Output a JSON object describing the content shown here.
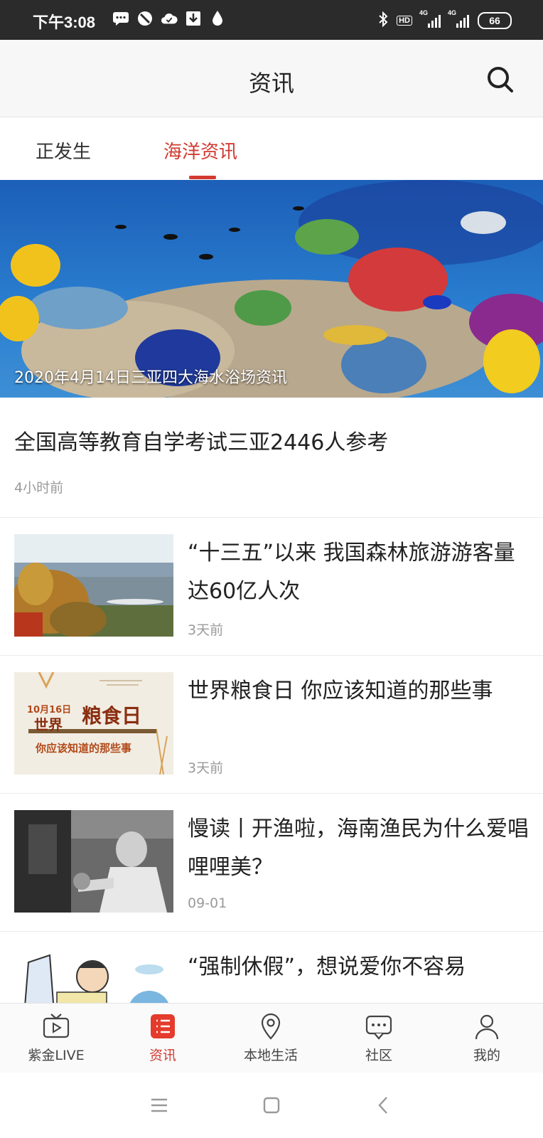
{
  "status_bar": {
    "time": "下午3:08",
    "left_icons": [
      "message-icon",
      "blocked-icon",
      "cloud-icon",
      "download-icon",
      "drop-icon"
    ],
    "right_icons": [
      "bluetooth-icon",
      "hd-icon",
      "signal-4g-icon",
      "signal-4g-icon"
    ],
    "hd_label": "HD",
    "network_label": "4G",
    "battery": "66"
  },
  "header": {
    "title": "资讯",
    "search_icon": "search-icon"
  },
  "tabs": [
    {
      "label": "正发生",
      "active": false
    },
    {
      "label": "海洋资讯",
      "active": true
    }
  ],
  "banner": {
    "caption": "2020年4月14日三亚四大海水浴场资讯"
  },
  "lead_article": {
    "title": "全国高等教育自学考试三亚2446人参考",
    "time": "4小时前"
  },
  "articles": [
    {
      "title": "“十三五”以来 我国森林旅游游客量达60亿人次",
      "time": "3天前",
      "thumb": "forest-lake-photo"
    },
    {
      "title": "世界粮食日 你应该知道的那些事",
      "time": "3天前",
      "thumb": "food-day-poster",
      "thumb_text": {
        "date": "10月16日",
        "line1": "世界",
        "line2": "粮食日",
        "line3": "你应该知道的那些事"
      }
    },
    {
      "title": "慢读丨开渔啦，海南渔民为什么爱唱哩哩美？",
      "time": "09-01",
      "thumb": "fisherman-photo"
    },
    {
      "title": "“强制休假”，想说爱你不容易",
      "time": "",
      "thumb": "cartoon-illustration"
    }
  ],
  "bottom_nav": [
    {
      "label": "紫金LIVE",
      "icon": "tv-icon",
      "active": false
    },
    {
      "label": "资讯",
      "icon": "news-list-icon",
      "active": true
    },
    {
      "label": "本地生活",
      "icon": "location-pin-icon",
      "active": false
    },
    {
      "label": "社区",
      "icon": "chat-bubble-icon",
      "active": false
    },
    {
      "label": "我的",
      "icon": "person-icon",
      "active": false
    }
  ],
  "system_nav": [
    "menu-icon",
    "home-icon",
    "back-icon"
  ],
  "colors": {
    "accent": "#d23a30",
    "status_bar": "#2b2b2b"
  }
}
